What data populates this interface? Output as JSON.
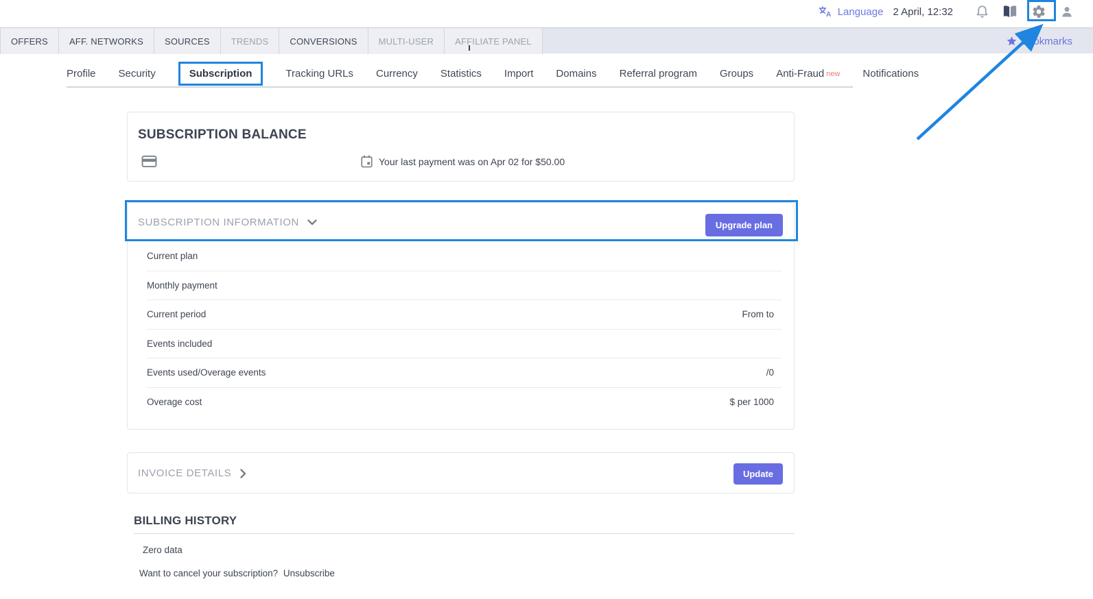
{
  "topbar": {
    "language_label": "Language",
    "datetime": "2 April, 12:32"
  },
  "main_nav": {
    "tabs": [
      {
        "label": "OFFERS"
      },
      {
        "label": "AFF. NETWORKS"
      },
      {
        "label": "SOURCES"
      },
      {
        "label": "TRENDS"
      },
      {
        "label": "CONVERSIONS"
      },
      {
        "label": "MULTI-USER"
      },
      {
        "label": "AFFILIATE PANEL"
      }
    ],
    "bookmarks_label": "Bookmarks"
  },
  "settings_tabs": {
    "active": "Subscription",
    "items": [
      {
        "label": "Profile"
      },
      {
        "label": "Security"
      },
      {
        "label": "Subscription"
      },
      {
        "label": "Tracking URLs"
      },
      {
        "label": "Currency"
      },
      {
        "label": "Statistics"
      },
      {
        "label": "Import"
      },
      {
        "label": "Domains"
      },
      {
        "label": "Referral program"
      },
      {
        "label": "Groups"
      },
      {
        "label": "Anti-Fraud",
        "badge": "new"
      },
      {
        "label": "Notifications"
      }
    ]
  },
  "subscription_balance": {
    "title": "SUBSCRIPTION BALANCE",
    "last_payment_text": "Your last payment was on Apr 02 for $50.00"
  },
  "subscription_information": {
    "title": "SUBSCRIPTION INFORMATION",
    "upgrade_button_label": "Upgrade plan",
    "rows": [
      {
        "label": "Current plan",
        "value": ""
      },
      {
        "label": "Monthly payment",
        "value": ""
      },
      {
        "label": "Current period",
        "value": "From to"
      },
      {
        "label": "Events included",
        "value": ""
      },
      {
        "label": "Events used/Overage events",
        "value": "/0"
      },
      {
        "label": "Overage cost",
        "value": "$ per 1000"
      }
    ]
  },
  "invoice_details": {
    "title": "INVOICE DETAILS",
    "update_button_label": "Update"
  },
  "billing_history": {
    "title": "BILLING HISTORY",
    "empty_text": "Zero data",
    "cancel_text": "Want to cancel your subscription?",
    "unsubscribe_label": "Unsubscribe"
  },
  "colors": {
    "annotation_blue": "#1f85e0",
    "accent_purple": "#696de2",
    "link_purple": "#6b79e2",
    "band_background": "#e3e6ee",
    "muted_gray": "#9ba1ab",
    "text_dark": "#3e4551",
    "badge_red": "#ee7a7a"
  }
}
